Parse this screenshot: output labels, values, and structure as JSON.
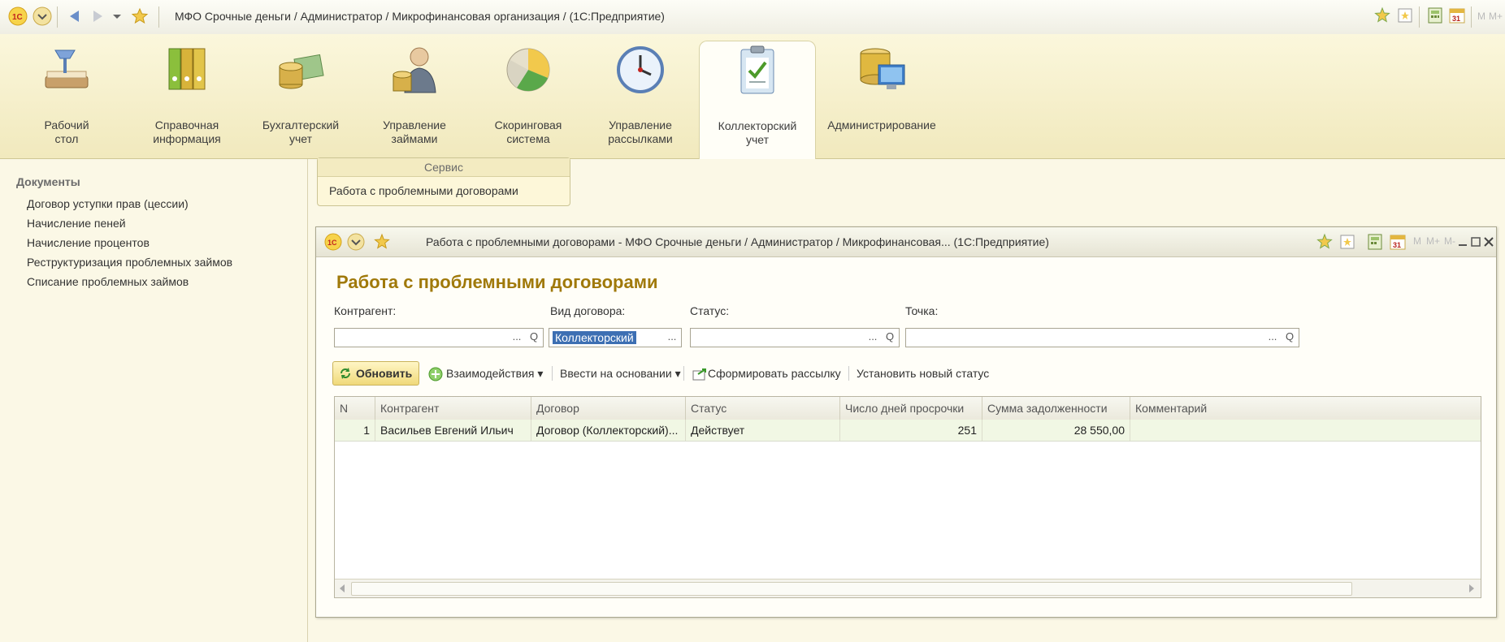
{
  "app": {
    "title": "МФО Срочные деньги / Администратор / Микрофинансовая организация / (1С:Предприятие)",
    "top_right_letters": [
      "M",
      "M+"
    ]
  },
  "sections": [
    {
      "label_line1": "Рабочий",
      "label_line2": "стол",
      "icon": "desk-lamp-icon"
    },
    {
      "label_line1": "Справочная",
      "label_line2": "информация",
      "icon": "binders-icon"
    },
    {
      "label_line1": "Бухгалтерский",
      "label_line2": "учет",
      "icon": "coins-bills-icon"
    },
    {
      "label_line1": "Управление",
      "label_line2": "займами",
      "icon": "person-coins-icon"
    },
    {
      "label_line1": "Скоринговая",
      "label_line2": "система",
      "icon": "pie-chart-icon"
    },
    {
      "label_line1": "Управление",
      "label_line2": "рассылками",
      "icon": "clock-icon"
    },
    {
      "label_line1": "Коллекторский",
      "label_line2": "учет",
      "icon": "clipboard-check-icon",
      "active": true
    },
    {
      "label_line1": "Администрирование",
      "label_line2": "",
      "icon": "database-monitor-icon"
    }
  ],
  "leftnav": {
    "heading": "Документы",
    "items": [
      "Договор уступки прав (цессии)",
      "Начисление пеней",
      "Начисление процентов",
      "Реструктуризация проблемных займов",
      "Списание проблемных займов"
    ]
  },
  "service": {
    "title": "Сервис",
    "link": "Работа с проблемными договорами"
  },
  "window": {
    "title": "Работа с проблемными договорами - МФО Срочные деньги / Администратор /  Микрофинансовая... (1С:Предприятие)",
    "heading": "Работа с проблемными договорами",
    "right_letters": [
      "M",
      "M+",
      "M-"
    ]
  },
  "filters": {
    "counterparty_label": "Контрагент:",
    "counterparty_value": "",
    "contract_type_label": "Вид договора:",
    "contract_type_value": "Коллекторский",
    "status_label": "Статус:",
    "status_value": "",
    "point_label": "Точка:",
    "point_value": "",
    "dots": "...",
    "search_glyph": "Q"
  },
  "toolbar": {
    "refresh": "Обновить",
    "interactions": "Взаимодействия",
    "enter_based_on": "Ввести на основании",
    "create_mailing": "Сформировать рассылку",
    "set_status": "Установить новый статус"
  },
  "grid": {
    "columns": [
      "N",
      "Контрагент",
      "Договор",
      "Статус",
      "Число дней просрочки",
      "Сумма задолженности",
      "Комментарий"
    ],
    "rows": [
      {
        "n": "1",
        "counterparty": "Васильев Евгений Ильич",
        "contract": "Договор (Коллекторский)...",
        "status": "Действует",
        "days_overdue": "251",
        "debt": "28 550,00",
        "comment": ""
      }
    ]
  }
}
